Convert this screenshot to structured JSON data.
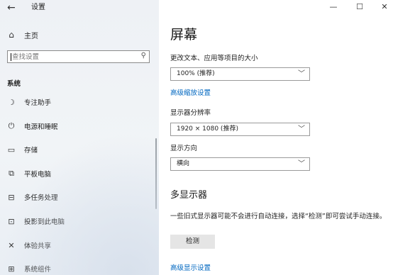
{
  "window": {
    "title": "设置",
    "back_icon": "←",
    "minimize_icon": "—",
    "maximize_icon": "☐",
    "close_icon": "✕"
  },
  "sidebar": {
    "home": {
      "icon": "⌂",
      "label": "主页"
    },
    "search": {
      "placeholder": "查找设置",
      "icon": "⚲"
    },
    "section_title": "系统",
    "items": [
      {
        "icon": "☽",
        "label": "专注助手"
      },
      {
        "icon": "⏻",
        "label": "电源和睡眠"
      },
      {
        "icon": "▭",
        "label": "存储"
      },
      {
        "icon": "⧉",
        "label": "平板电脑"
      },
      {
        "icon": "⊟",
        "label": "多任务处理"
      },
      {
        "icon": "⊡",
        "label": "投影到此电脑"
      },
      {
        "icon": "✕",
        "label": "体验共享"
      },
      {
        "icon": "⊞",
        "label": "系统组件"
      }
    ]
  },
  "main": {
    "title": "屏幕",
    "scale": {
      "label": "更改文本、应用等项目的大小",
      "value": "100% (推荐)"
    },
    "advanced_scale_link": "高级缩放设置",
    "resolution": {
      "label": "显示器分辨率",
      "value": "1920 × 1080 (推荐)"
    },
    "orientation": {
      "label": "显示方向",
      "value": "横向"
    },
    "multi_display": {
      "title": "多显示器",
      "description": "一些旧式显示器可能不会进行自动连接，选择“检测”即可尝试手动连接。",
      "detect_button": "检测"
    },
    "advanced_display_link": "高级显示设置"
  }
}
